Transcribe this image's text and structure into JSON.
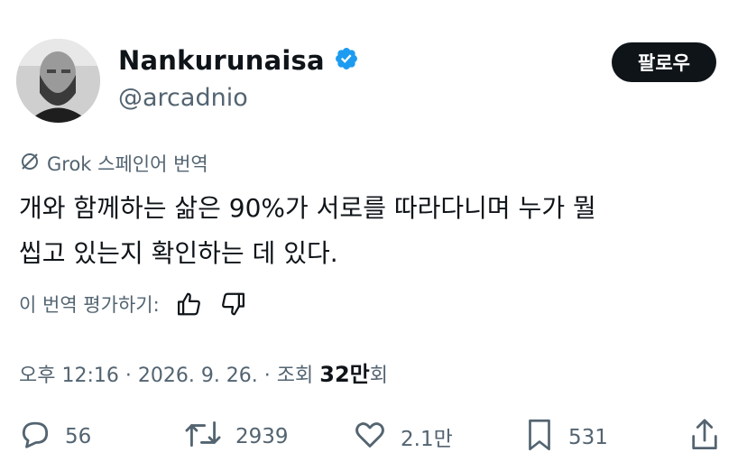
{
  "user": {
    "display_name": "Nankurunaisa",
    "handle": "@arcadnio",
    "verified": true,
    "avatar_icon": "profile-photo"
  },
  "follow_label": "팔로우",
  "translation": {
    "label": "Grok 스페인어 번역",
    "icon": "grok-icon"
  },
  "tweet_lines": [
    "개와 함께하는 삶은 90%가 서로를 따라다니며 누가 뭘",
    "씹고 있는지 확인하는 데 있다."
  ],
  "rate": {
    "label": "이 번역 평가하기:",
    "up_icon": "thumbs-up-icon",
    "down_icon": "thumbs-down-icon"
  },
  "meta": {
    "prefix": "오후 12:16 · 2026. 9. 26. · 조회 ",
    "views": "32만",
    "suffix": "회"
  },
  "actions": {
    "replies": "56",
    "reposts": "2939",
    "likes": "2.1만",
    "bookmarks": "531"
  },
  "colors": {
    "verified": "#1d9bf0",
    "text": "#0f1419",
    "muted": "#536471",
    "button_bg": "#0f1419"
  }
}
